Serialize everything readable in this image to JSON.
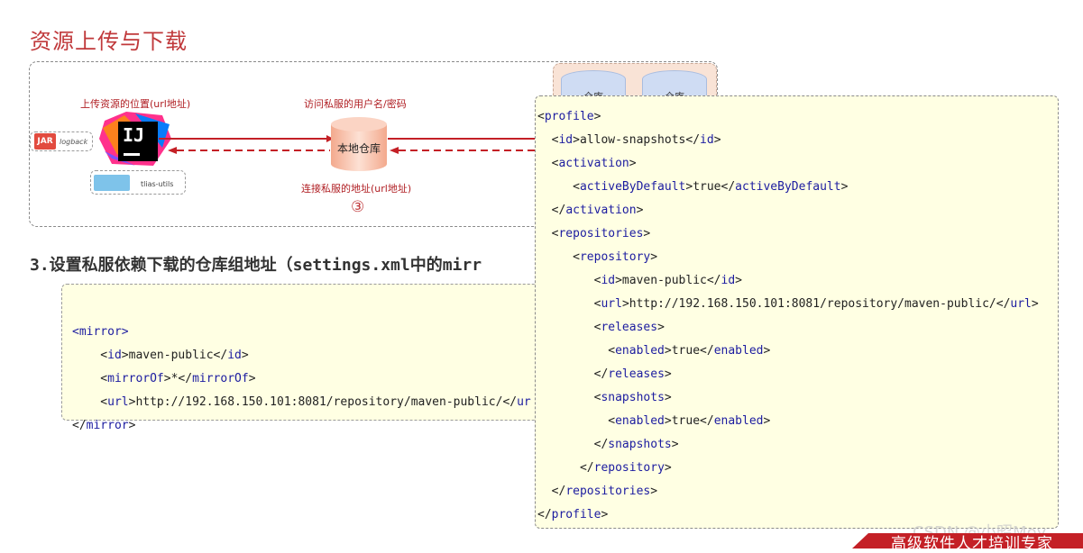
{
  "title": "资源上传与下载",
  "diagram": {
    "upload_label": "上传资源的位置(url地址)",
    "credentials_label": "访问私服的用户名/密码",
    "local_repo_label": "本地仓库",
    "connect_label": "连接私服的地址(url地址)",
    "step_number": "③",
    "jar_name": "logback",
    "jar_badge": "JAR",
    "folder_name": "tlias-utils",
    "ij_text": "IJ",
    "warehouse_1": "仓库",
    "warehouse_2": "仓库"
  },
  "section_heading": "3.设置私服依赖下载的仓库组地址（settings.xml中的mirr",
  "mirror_code": {
    "open": "mirror",
    "lines": [
      {
        "tag": "id",
        "value": "maven-public"
      },
      {
        "tag": "mirrorOf",
        "value": "*"
      },
      {
        "tag": "url",
        "value": "http://192.168.150.101:8081/repository/maven-public/"
      }
    ],
    "url_truncated": "http://192.168.150.101:8081/repository/maven-public/</ur"
  },
  "profile_code": {
    "lines": [
      "<profile>",
      "  <id>allow-snapshots</id>",
      "  <activation>",
      "     <activeByDefault>true</activeByDefault>",
      "  </activation>",
      "  <repositories>",
      "     <repository>",
      "        <id>maven-public</id>",
      "        <url>http://192.168.150.101:8081/repository/maven-public/</url>",
      "        <releases>",
      "          <enabled>true</enabled>",
      "        </releases>",
      "        <snapshots>",
      "          <enabled>true</enabled>",
      "        </snapshots>",
      "      </repository>",
      "  </repositories>",
      "</profile>"
    ]
  },
  "footer": {
    "watermark": "CSDN @小昭Moy",
    "banner": "高级软件人才培训专家"
  }
}
